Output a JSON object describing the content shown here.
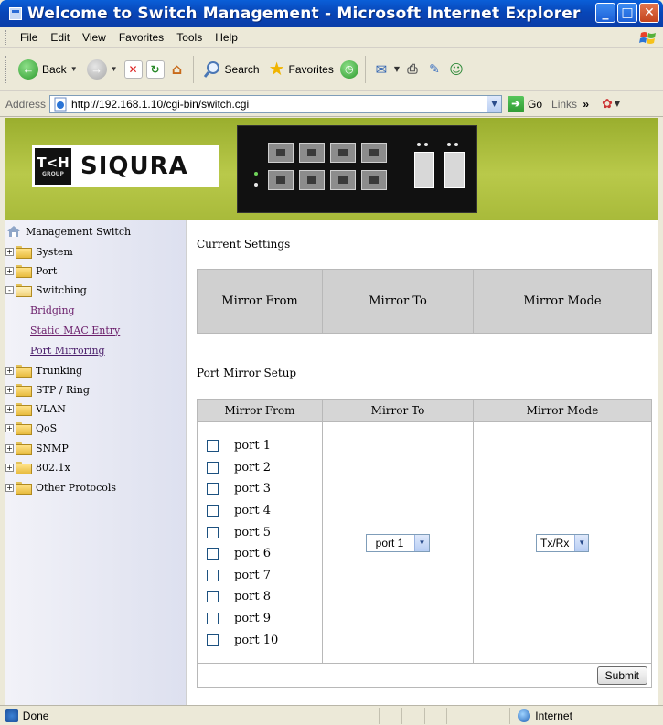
{
  "window": {
    "title": "Welcome to Switch Management - Microsoft Internet Explorer",
    "min": "_",
    "max": "□",
    "close": "✕"
  },
  "menu": [
    "File",
    "Edit",
    "View",
    "Favorites",
    "Tools",
    "Help"
  ],
  "toolbar": {
    "back": "Back",
    "search": "Search",
    "favorites": "Favorites"
  },
  "address": {
    "label": "Address",
    "url": "http://192.168.1.10/cgi-bin/switch.cgi",
    "go": "Go",
    "links": "Links",
    "chevron": "»"
  },
  "banner": {
    "logo_mark": "T<H",
    "logo_group": "GROUP",
    "logo_text": "SIQURA"
  },
  "sidebar": {
    "root": "Management Switch",
    "items": [
      {
        "label": "System",
        "expander": "+"
      },
      {
        "label": "Port",
        "expander": "+"
      },
      {
        "label": "Switching",
        "expander": "-"
      },
      {
        "label": "Trunking",
        "expander": "+"
      },
      {
        "label": "STP / Ring",
        "expander": "+"
      },
      {
        "label": "VLAN",
        "expander": "+"
      },
      {
        "label": "QoS",
        "expander": "+"
      },
      {
        "label": "SNMP",
        "expander": "+"
      },
      {
        "label": "802.1x",
        "expander": "+"
      },
      {
        "label": "Other Protocols",
        "expander": "+"
      }
    ],
    "switching_children": [
      "Bridging",
      "Static MAC Entry",
      "Port Mirroring"
    ]
  },
  "content": {
    "current_title": "Current Settings",
    "setup_title": "Port Mirror Setup",
    "columns": [
      "Mirror From",
      "Mirror To",
      "Mirror Mode"
    ],
    "ports": [
      "port 1",
      "port 2",
      "port 3",
      "port 4",
      "port 5",
      "port 6",
      "port 7",
      "port 8",
      "port 9",
      "port 10"
    ],
    "mirror_to": "port 1",
    "mirror_mode": "Tx/Rx",
    "submit": "Submit"
  },
  "status": {
    "text": "Done",
    "zone": "Internet"
  },
  "colors": {
    "banner": "#a8ba3a",
    "titlebar": "#0a5fd8",
    "link": "#6b1f6b"
  }
}
